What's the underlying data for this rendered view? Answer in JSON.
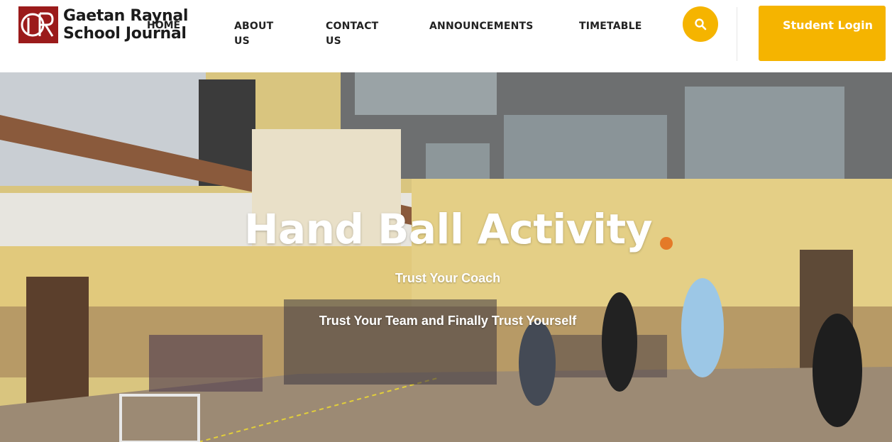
{
  "brand": {
    "line1": "Gaetan Raynal",
    "line2": "School Journal",
    "color": "#9b1b1b"
  },
  "nav": {
    "home": "HOME",
    "about": "ABOUT US",
    "contact": "CONTACT US",
    "announcements": "ANNOUNCEMENTS",
    "timetable": "TIMETABLE"
  },
  "search": {
    "icon": "search-icon"
  },
  "login": {
    "label": "Student Login"
  },
  "hero": {
    "title": "Hand Ball Activity",
    "subtitle1": "Trust Your Coach",
    "subtitle2": "Trust Your Team and Finally Trust Yourself"
  },
  "colors": {
    "accent": "#f5b400",
    "text": "#222222"
  }
}
